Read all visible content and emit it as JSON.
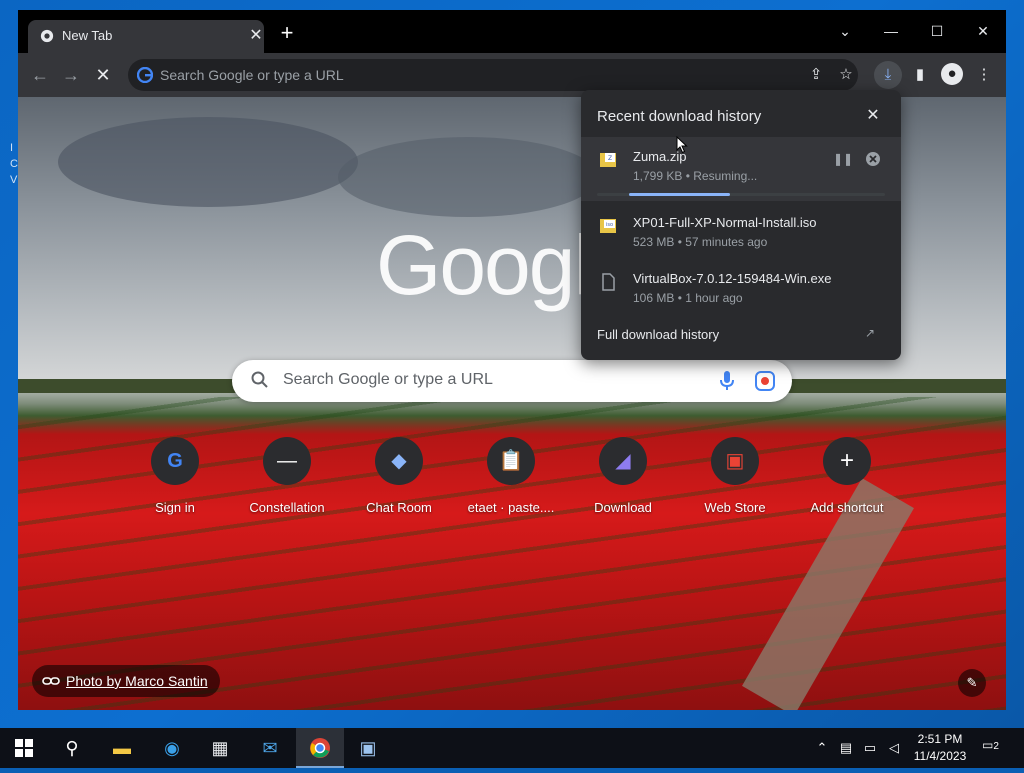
{
  "tab": {
    "title": "New Tab"
  },
  "omnibox": {
    "placeholder": "Search Google or type a URL"
  },
  "ntp": {
    "logo_text": "Google",
    "search_placeholder": "Search Google or type a URL",
    "shortcuts": [
      {
        "label": "Sign in",
        "icon": "google-icon"
      },
      {
        "label": "Constellation",
        "icon": "dash-icon"
      },
      {
        "label": "Chat Room",
        "icon": "chat-room-icon"
      },
      {
        "label": "etaet · paste....",
        "icon": "clipboard-icon"
      },
      {
        "label": "Download",
        "icon": "download-app-icon"
      },
      {
        "label": "Web Store",
        "icon": "web-store-icon"
      },
      {
        "label": "Add shortcut",
        "icon": "plus-icon"
      }
    ],
    "photo_credit": "Photo by Marco Santin"
  },
  "downloads": {
    "title": "Recent download history",
    "items": [
      {
        "name": "Zuma.zip",
        "meta": "1,799 KB • Resuming...",
        "progress": 0.35
      },
      {
        "name": "XP01-Full-XP-Normal-Install.iso",
        "meta": "523 MB • 57 minutes ago"
      },
      {
        "name": "VirtualBox-7.0.12-159484-Win.exe",
        "meta": "106 MB • 1 hour ago"
      }
    ],
    "full_history": "Full download history"
  },
  "taskbar": {
    "time": "2:51 PM",
    "date": "11/4/2023",
    "notification_count": "2"
  },
  "colors": {
    "accent": "#8ab4f8",
    "toolbar": "#35363a",
    "tabstrip": "#000000"
  }
}
